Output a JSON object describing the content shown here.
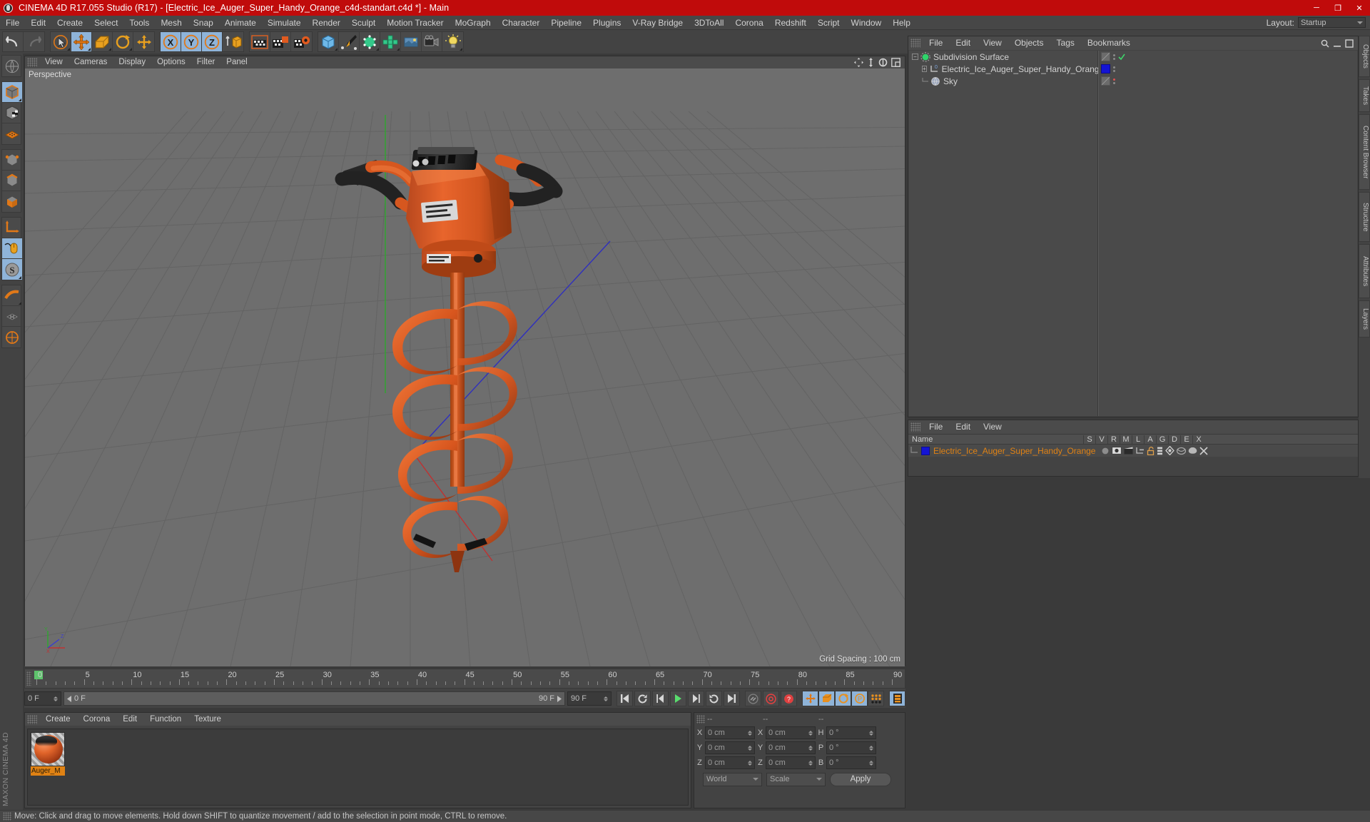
{
  "titlebar": {
    "title": "CINEMA 4D R17.055 Studio (R17) - [Electric_Ice_Auger_Super_Handy_Orange_c4d-standart.c4d *] - Main",
    "minimize": "─",
    "maximize": "❐",
    "close": "✕"
  },
  "menubar": {
    "items": [
      "File",
      "Edit",
      "Create",
      "Select",
      "Tools",
      "Mesh",
      "Snap",
      "Animate",
      "Simulate",
      "Render",
      "Sculpt",
      "Motion Tracker",
      "MoGraph",
      "Character",
      "Pipeline",
      "Plugins",
      "V-Ray Bridge",
      "3DToAll",
      "Corona",
      "Redshift",
      "Script",
      "Window",
      "Help"
    ],
    "layout_label": "Layout:",
    "layout_value": "Startup"
  },
  "viewport": {
    "menu": [
      "View",
      "Cameras",
      "Display",
      "Options",
      "Filter",
      "Panel"
    ],
    "label": "Perspective",
    "grid_spacing": "Grid Spacing : 100 cm",
    "axis_x": "X",
    "axis_y": "Y",
    "axis_z": "Z"
  },
  "timeline": {
    "labels": [
      "0",
      "5",
      "10",
      "15",
      "20",
      "25",
      "30",
      "35",
      "40",
      "45",
      "50",
      "55",
      "60",
      "65",
      "70",
      "75",
      "80",
      "85",
      "90"
    ],
    "current_frame": "0 F",
    "range_start": "0 F",
    "range_end": "90 F",
    "end_field": "90 F"
  },
  "material_manager": {
    "menu": [
      "Create",
      "Corona",
      "Edit",
      "Function",
      "Texture"
    ],
    "materials": [
      {
        "name": "Auger_M"
      }
    ]
  },
  "coordinates": {
    "header": [
      "--",
      "--",
      "--"
    ],
    "rows": [
      {
        "pos_label": "X",
        "pos_value": "0 cm",
        "size_label": "X",
        "size_value": "0 cm",
        "rot_label": "H",
        "rot_value": "0 °"
      },
      {
        "pos_label": "Y",
        "pos_value": "0 cm",
        "size_label": "Y",
        "size_value": "0 cm",
        "rot_label": "P",
        "rot_value": "0 °"
      },
      {
        "pos_label": "Z",
        "pos_value": "0 cm",
        "size_label": "Z",
        "size_value": "0 cm",
        "rot_label": "B",
        "rot_value": "0 °"
      }
    ],
    "world_dropdown": "World",
    "scale_dropdown": "Scale",
    "apply_button": "Apply"
  },
  "object_manager": {
    "menu": [
      "File",
      "Edit",
      "View",
      "Objects",
      "Tags",
      "Bookmarks"
    ],
    "objects": [
      {
        "name": "Subdivision Surface",
        "icon": "subdivision-surface-icon",
        "depth": 0,
        "tag": "none",
        "check": true
      },
      {
        "name": "Electric_Ice_Auger_Super_Handy_Orange",
        "icon": "null-object-icon",
        "depth": 1,
        "tag": "blue",
        "check": false
      },
      {
        "name": "Sky",
        "icon": "sky-icon",
        "depth": 1,
        "tag": "none",
        "check": false
      }
    ]
  },
  "material_list": {
    "menu": [
      "File",
      "Edit",
      "View"
    ],
    "name_header": "Name",
    "columns": [
      "S",
      "V",
      "R",
      "M",
      "L",
      "A",
      "G",
      "D",
      "E",
      "X"
    ],
    "rows": [
      {
        "name": "Electric_Ice_Auger_Super_Handy_Orange"
      }
    ]
  },
  "right_tabs": [
    "Objects",
    "Takes",
    "Content Browser",
    "Structure",
    "Attributes",
    "Layers"
  ],
  "statusbar": {
    "message": "Move: Click and drag to move elements. Hold down SHIFT to quantize movement / add to the selection in point mode, CTRL to remove."
  },
  "branding": {
    "text": "MAXON CINEMA 4D"
  },
  "colors": {
    "title_red": "#c00b0b",
    "accent_orange": "#e08214",
    "panel_bg": "#434343",
    "viewport_bg": "#6e6e6e",
    "selected_blue": "#8fb4d9",
    "tag_blue": "#1414d4"
  },
  "toolbar": {
    "groups": [
      {
        "buttons": [
          {
            "icon": "undo-icon",
            "on": false
          },
          {
            "icon": "redo-icon",
            "on": false
          }
        ]
      },
      {
        "buttons": [
          {
            "icon": "live-selection-icon",
            "on": false
          },
          {
            "icon": "move-icon",
            "on": true
          },
          {
            "icon": "scale-icon",
            "on": false
          },
          {
            "icon": "rotate-icon",
            "on": false
          },
          {
            "icon": "move-world-icon",
            "on": false
          }
        ]
      },
      {
        "buttons": [
          {
            "icon": "x-axis-icon",
            "on": true
          },
          {
            "icon": "y-axis-icon",
            "on": true
          },
          {
            "icon": "z-axis-icon",
            "on": true
          },
          {
            "icon": "world-object-icon",
            "on": false
          }
        ]
      },
      {
        "buttons": [
          {
            "icon": "render-view-icon",
            "on": false
          },
          {
            "icon": "render-picture-viewer-icon",
            "on": false
          },
          {
            "icon": "render-settings-icon",
            "on": false
          }
        ]
      },
      {
        "buttons": [
          {
            "icon": "cube-primitive-icon",
            "on": false
          },
          {
            "icon": "spline-pen-icon",
            "on": false
          },
          {
            "icon": "nurbs-icon",
            "on": false
          },
          {
            "icon": "array-icon",
            "on": false
          },
          {
            "icon": "scene-icon",
            "on": false
          },
          {
            "icon": "camera-icon",
            "on": false
          },
          {
            "icon": "light-icon",
            "on": false
          }
        ]
      }
    ]
  },
  "left_toolbar": {
    "groups": [
      {
        "buttons": [
          {
            "icon": "make-editable-icon",
            "on": false
          }
        ]
      },
      {
        "buttons": [
          {
            "icon": "model-mode-icon",
            "on": true
          },
          {
            "icon": "texture-mode-icon",
            "on": false
          },
          {
            "icon": "workplane-icon",
            "on": false
          }
        ]
      },
      {
        "buttons": [
          {
            "icon": "points-mode-icon",
            "on": false
          },
          {
            "icon": "edges-mode-icon",
            "on": false
          },
          {
            "icon": "polygons-mode-icon",
            "on": false
          }
        ]
      },
      {
        "buttons": [
          {
            "icon": "object-axis-icon",
            "on": false
          },
          {
            "icon": "enable-axis-icon",
            "on": true
          },
          {
            "icon": "snap-icon",
            "on": true
          }
        ]
      },
      {
        "buttons": [
          {
            "icon": "workplane-lock-icon",
            "on": false
          },
          {
            "icon": "quantize-icon",
            "on": false
          },
          {
            "icon": "world-axis-icon",
            "on": false
          }
        ]
      }
    ]
  },
  "playback": {
    "buttons": [
      "go-to-start",
      "play-reverse-frame",
      "step-back",
      "play",
      "step-forward",
      "loop",
      "go-to-end"
    ],
    "record_buttons": [
      "autokey-icon",
      "record-active-objects-icon",
      "keyframe-selection-icon"
    ],
    "key_toggles": [
      "position-key-icon",
      "scale-key-icon",
      "rotation-key-icon",
      "param-key-icon",
      "pla-key-icon"
    ],
    "timeline_button": "timeline-icon"
  }
}
